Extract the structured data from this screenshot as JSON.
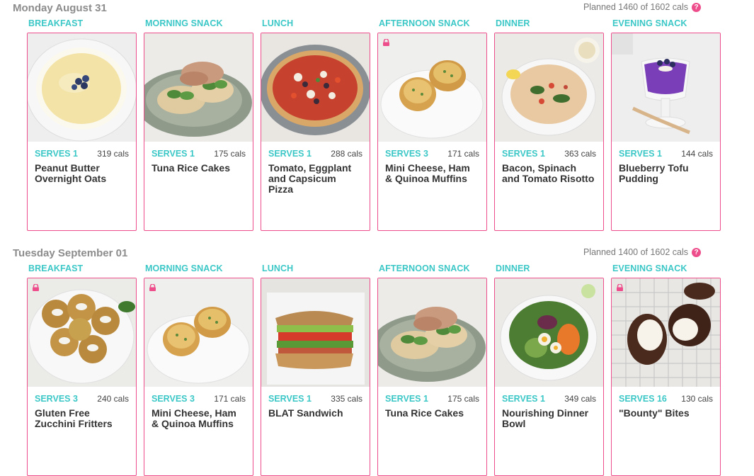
{
  "days": [
    {
      "title": "Monday August 31",
      "planned": "Planned 1460 of 1602 cals",
      "meals": [
        {
          "label": "BREAKFAST",
          "serves": "SERVES 1",
          "cals": "319 cals",
          "name": "Peanut Butter Overnight Oats",
          "photo": "oats-photo",
          "locked": false
        },
        {
          "label": "MORNING SNACK",
          "serves": "SERVES 1",
          "cals": "175 cals",
          "name": "Tuna Rice Cakes",
          "photo": "tuna-rice-cakes-photo",
          "locked": false
        },
        {
          "label": "LUNCH",
          "serves": "SERVES 1",
          "cals": "288 cals",
          "name": "Tomato, Eggplant and Capsicum Pizza",
          "photo": "pizza-photo",
          "locked": false
        },
        {
          "label": "AFTERNOON SNACK",
          "serves": "SERVES 3",
          "cals": "171 cals",
          "name": "Mini Cheese, Ham & Quinoa Muffins",
          "photo": "muffins-photo",
          "locked": true
        },
        {
          "label": "DINNER",
          "serves": "SERVES 1",
          "cals": "363 cals",
          "name": "Bacon, Spinach and Tomato Risotto",
          "photo": "risotto-photo",
          "locked": false
        },
        {
          "label": "EVENING SNACK",
          "serves": "SERVES 1",
          "cals": "144 cals",
          "name": "Blueberry Tofu Pudding",
          "photo": "pudding-photo",
          "locked": false
        }
      ]
    },
    {
      "title": "Tuesday September 01",
      "planned": "Planned 1400 of 1602 cals",
      "meals": [
        {
          "label": "BREAKFAST",
          "serves": "SERVES 3",
          "cals": "240 cals",
          "name": "Gluten Free Zucchini Fritters",
          "photo": "fritters-photo",
          "locked": true
        },
        {
          "label": "MORNING SNACK",
          "serves": "SERVES 3",
          "cals": "171 cals",
          "name": "Mini Cheese, Ham & Quinoa Muffins",
          "photo": "muffins-photo",
          "locked": true
        },
        {
          "label": "LUNCH",
          "serves": "SERVES 1",
          "cals": "335 cals",
          "name": "BLAT Sandwich",
          "photo": "sandwich-photo",
          "locked": false
        },
        {
          "label": "AFTERNOON SNACK",
          "serves": "SERVES 1",
          "cals": "175 cals",
          "name": "Tuna Rice Cakes",
          "photo": "tuna-rice-cakes-photo",
          "locked": false
        },
        {
          "label": "DINNER",
          "serves": "SERVES 1",
          "cals": "349 cals",
          "name": "Nourishing Dinner Bowl",
          "photo": "dinner-bowl-photo",
          "locked": false
        },
        {
          "label": "EVENING SNACK",
          "serves": "SERVES 16",
          "cals": "130 cals",
          "name": "\"Bounty\" Bites",
          "photo": "bounty-bites-photo",
          "locked": true
        }
      ]
    }
  ],
  "colors": {
    "accent_teal": "#3cc7c7",
    "accent_pink": "#ee4d8b",
    "day_title": "#8c8c8c"
  },
  "icons": {
    "help": "help-circle-icon",
    "lock": "lock-icon"
  }
}
